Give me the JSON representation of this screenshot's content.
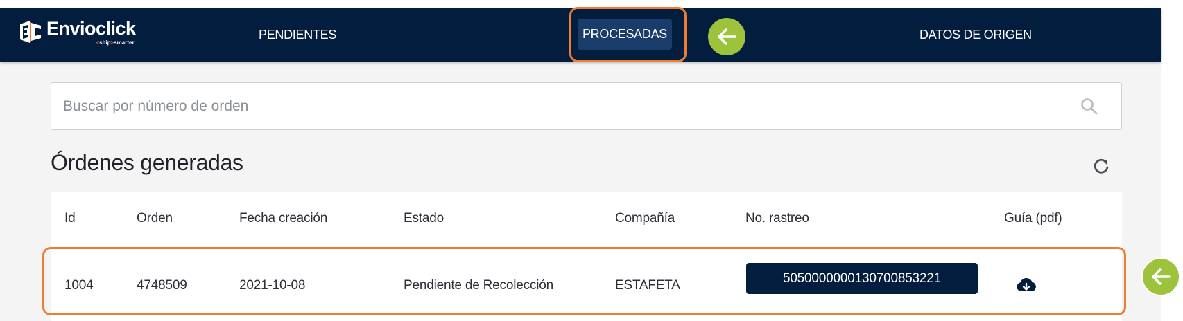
{
  "brand": {
    "name": "Envioclick",
    "tagline_prefix": "<",
    "tagline_mid": "ship",
    "tagline_sep": ">",
    "tagline_end": "smarter",
    "accent": "#f07c2f",
    "navy": "#031d3f"
  },
  "nav": {
    "pendientes": "PENDIENTES",
    "procesadas": "PROCESADAS",
    "datos_origen": "DATOS DE ORIGEN"
  },
  "search": {
    "placeholder": "Buscar por número de orden",
    "value": ""
  },
  "section": {
    "title": "Órdenes generadas"
  },
  "table": {
    "headers": {
      "id": "Id",
      "orden": "Orden",
      "fecha": "Fecha creación",
      "estado": "Estado",
      "compania": "Compañía",
      "rastreo": "No. rastreo",
      "guia": "Guía (pdf)"
    },
    "rows": [
      {
        "id": "1004",
        "orden": "4748509",
        "fecha": "2021-10-08",
        "estado": "Pendiente de Recolección",
        "compania": "ESTAFETA",
        "rastreo": "5050000000130700853221"
      }
    ]
  },
  "icons": {
    "search": "search-icon",
    "refresh": "refresh-icon",
    "download": "cloud-download-icon",
    "arrow": "arrow-left-icon"
  },
  "annotation_color": "#9dc23b"
}
